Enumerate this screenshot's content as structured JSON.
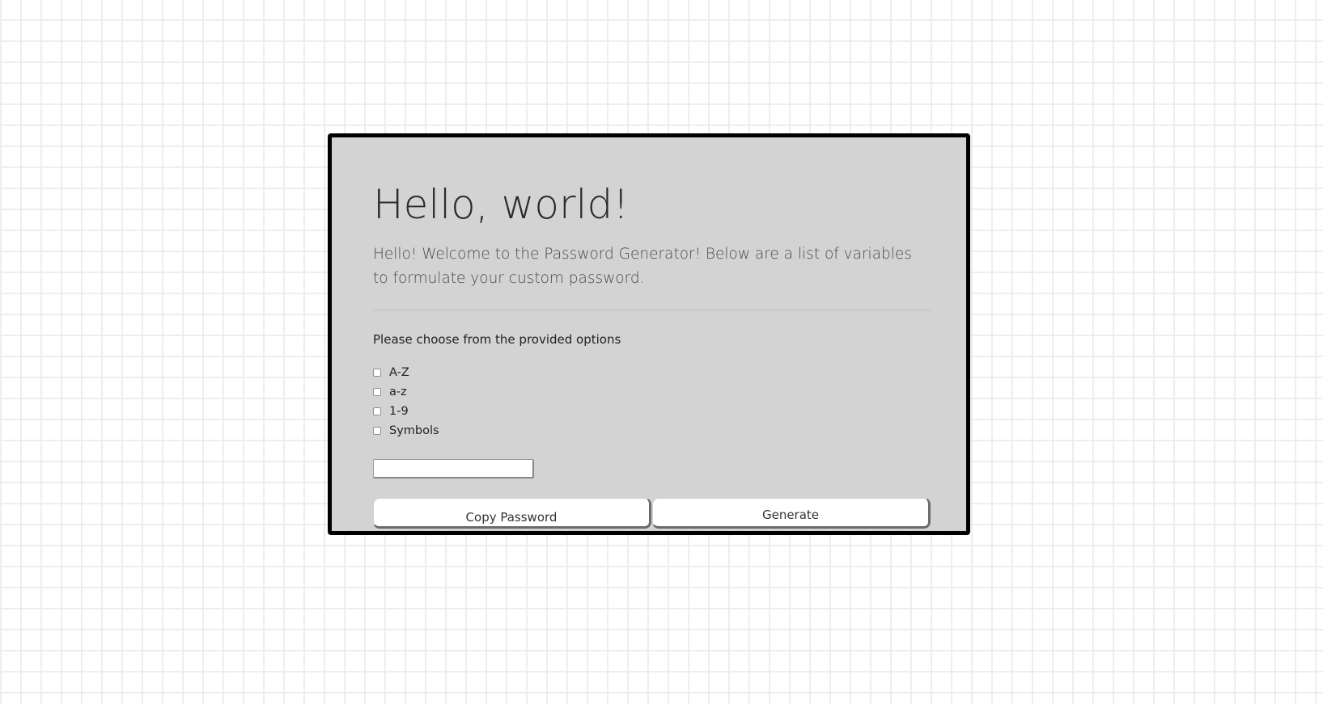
{
  "jumbotron": {
    "title": "Hello, world!",
    "lead": "Hello! Welcome to the Password Generator! Below are a list of variables to formulate your custom password.",
    "prompt": "Please choose from the provided options"
  },
  "options": [
    {
      "label": "A-Z",
      "checked": false
    },
    {
      "label": "a-z",
      "checked": false
    },
    {
      "label": "1-9",
      "checked": false
    },
    {
      "label": "Symbols",
      "checked": false
    }
  ],
  "password_field": {
    "value": ""
  },
  "buttons": {
    "copy_label": "Copy Password",
    "generate_label": "Generate"
  }
}
